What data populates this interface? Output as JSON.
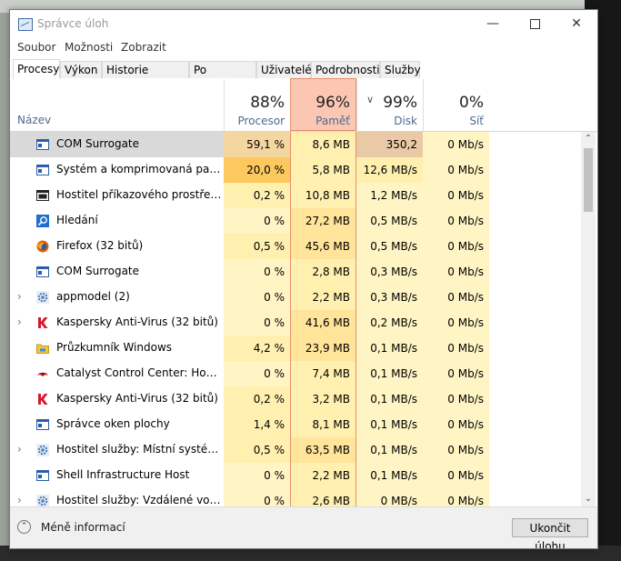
{
  "window": {
    "title": "Správce úloh",
    "controls": {
      "minimize": "—",
      "maximize": "",
      "close": "✕"
    }
  },
  "menu": [
    "Soubor",
    "Možnosti",
    "Zobrazit"
  ],
  "tabs": [
    "Procesy",
    "Výkon",
    "Historie aplikací",
    "Po spuštění",
    "Uživatelé",
    "Podrobnosti",
    "Služby"
  ],
  "active_tab": "Procesy",
  "columns": {
    "name": "Název",
    "cpu": {
      "pct": "88%",
      "label": "Procesor"
    },
    "mem": {
      "pct": "96%",
      "label": "Paměť"
    },
    "disk": {
      "pct": "99%",
      "label": "Disk"
    },
    "net": {
      "pct": "0%",
      "label": "Síť"
    }
  },
  "processes": [
    {
      "name": "COM Surrogate",
      "cpu": "59,1 %",
      "mem": "8,6 MB",
      "disk": "350,2 MB/s",
      "net": "0 Mb/s",
      "icon": "window-icon",
      "expandable": false,
      "selected": true
    },
    {
      "name": "Systém a komprimovaná paměť",
      "cpu": "20,0 %",
      "mem": "5,8 MB",
      "disk": "12,6 MB/s",
      "net": "0 Mb/s",
      "icon": "window-icon",
      "expandable": false
    },
    {
      "name": "Hostitel příkazového prostředí ...",
      "cpu": "0,2 %",
      "mem": "10,8 MB",
      "disk": "1,2 MB/s",
      "net": "0 Mb/s",
      "icon": "console-icon",
      "expandable": false
    },
    {
      "name": "Hledání",
      "cpu": "0 %",
      "mem": "27,2 MB",
      "disk": "0,5 MB/s",
      "net": "0 Mb/s",
      "icon": "search-icon",
      "expandable": false
    },
    {
      "name": "Firefox (32 bitů)",
      "cpu": "0,5 %",
      "mem": "45,6 MB",
      "disk": "0,5 MB/s",
      "net": "0 Mb/s",
      "icon": "firefox-icon",
      "expandable": false
    },
    {
      "name": "COM Surrogate",
      "cpu": "0 %",
      "mem": "2,8 MB",
      "disk": "0,3 MB/s",
      "net": "0 Mb/s",
      "icon": "window-icon",
      "expandable": false
    },
    {
      "name": "appmodel (2)",
      "cpu": "0 %",
      "mem": "2,2 MB",
      "disk": "0,3 MB/s",
      "net": "0 Mb/s",
      "icon": "gear-icon",
      "expandable": true
    },
    {
      "name": "Kaspersky Anti-Virus (32 bitů)",
      "cpu": "0 %",
      "mem": "41,6 MB",
      "disk": "0,2 MB/s",
      "net": "0 Mb/s",
      "icon": "kaspersky-icon",
      "expandable": true
    },
    {
      "name": "Průzkumník Windows",
      "cpu": "4,2 %",
      "mem": "23,9 MB",
      "disk": "0,1 MB/s",
      "net": "0 Mb/s",
      "icon": "folder-icon",
      "expandable": false
    },
    {
      "name": "Catalyst Control Center: Host a...",
      "cpu": "0 %",
      "mem": "7,4 MB",
      "disk": "0,1 MB/s",
      "net": "0 Mb/s",
      "icon": "catalyst-icon",
      "expandable": false
    },
    {
      "name": "Kaspersky Anti-Virus (32 bitů)",
      "cpu": "0,2 %",
      "mem": "3,2 MB",
      "disk": "0,1 MB/s",
      "net": "0 Mb/s",
      "icon": "kaspersky-icon",
      "expandable": false
    },
    {
      "name": "Správce oken plochy",
      "cpu": "1,4 %",
      "mem": "8,1 MB",
      "disk": "0,1 MB/s",
      "net": "0 Mb/s",
      "icon": "window-icon",
      "expandable": false
    },
    {
      "name": "Hostitel služby: Místní systém (...",
      "cpu": "0,5 %",
      "mem": "63,5 MB",
      "disk": "0,1 MB/s",
      "net": "0 Mb/s",
      "icon": "gear-icon",
      "expandable": true
    },
    {
      "name": "Shell Infrastructure Host",
      "cpu": "0 %",
      "mem": "2,2 MB",
      "disk": "0,1 MB/s",
      "net": "0 Mb/s",
      "icon": "window-icon",
      "expandable": false
    },
    {
      "name": "Hostitel služby: Vzdálené volání ...",
      "cpu": "0 %",
      "mem": "2,6 MB",
      "disk": "0 MB/s",
      "net": "0 Mb/s",
      "icon": "gear-icon",
      "expandable": true
    }
  ],
  "footer": {
    "fewer_details": "Méně informací",
    "end_task": "Ukončit úlohu"
  },
  "heat_colors": {
    "selected_cpu": "#f4d6a0",
    "selected_disk": "#e9c9a6",
    "cpu_high": "#fdc95e",
    "light": "#fff4c4",
    "medium": "#fff0b0",
    "mem_hot": "#ffe49a",
    "net": "#fff4c4",
    "mem_header": "#fbc7b2"
  }
}
